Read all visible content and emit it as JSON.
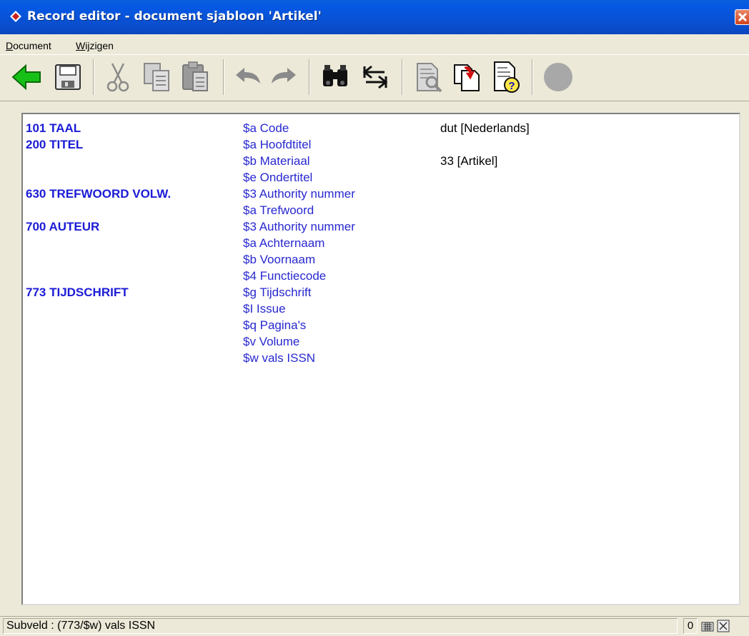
{
  "window": {
    "title": "Record editor - document sjabloon 'Artikel'"
  },
  "menu": {
    "items": [
      {
        "label": "Document",
        "accel": "D"
      },
      {
        "label": "Wijzigen",
        "accel": "W"
      }
    ]
  },
  "toolbar": {
    "icons": [
      "back-arrow-icon",
      "save-icon",
      "cut-icon",
      "copy-icon",
      "paste-icon",
      "undo-icon",
      "redo-icon",
      "find-icon",
      "swap-icon",
      "preview-icon",
      "replace-icon",
      "help-icon",
      "record-icon"
    ]
  },
  "fields": [
    {
      "tag": "101 TAAL",
      "sub": "$a Code",
      "value": "dut [Nederlands]"
    },
    {
      "tag": "200 TITEL",
      "sub": "$a Hoofdtitel",
      "value": ""
    },
    {
      "tag": "",
      "sub": "$b Materiaal",
      "value": "33 [Artikel]"
    },
    {
      "tag": "",
      "sub": "$e Ondertitel",
      "value": ""
    },
    {
      "tag": "630 TREFWOORD VOLW.",
      "sub": "$3 Authority nummer",
      "value": ""
    },
    {
      "tag": "",
      "sub": "$a Trefwoord",
      "value": ""
    },
    {
      "tag": "700 AUTEUR",
      "sub": "$3 Authority nummer",
      "value": ""
    },
    {
      "tag": "",
      "sub": "$a Achternaam",
      "value": ""
    },
    {
      "tag": "",
      "sub": "$b Voornaam",
      "value": ""
    },
    {
      "tag": "",
      "sub": "$4 Functiecode",
      "value": ""
    },
    {
      "tag": "773 TIJDSCHRIFT",
      "sub": "$g Tijdschrift",
      "value": ""
    },
    {
      "tag": "",
      "sub": "$I Issue",
      "value": ""
    },
    {
      "tag": "",
      "sub": "$q Pagina's",
      "value": ""
    },
    {
      "tag": "",
      "sub": "$v Volume",
      "value": ""
    },
    {
      "tag": "",
      "sub": "$w vals ISSN",
      "value": ""
    }
  ],
  "status": {
    "text": "Subveld : (773/$w) vals ISSN",
    "count": "0"
  },
  "colors": {
    "tag": "#1b1bd6",
    "subfield": "#2828d0",
    "titlebar": "#0a5fdc"
  }
}
